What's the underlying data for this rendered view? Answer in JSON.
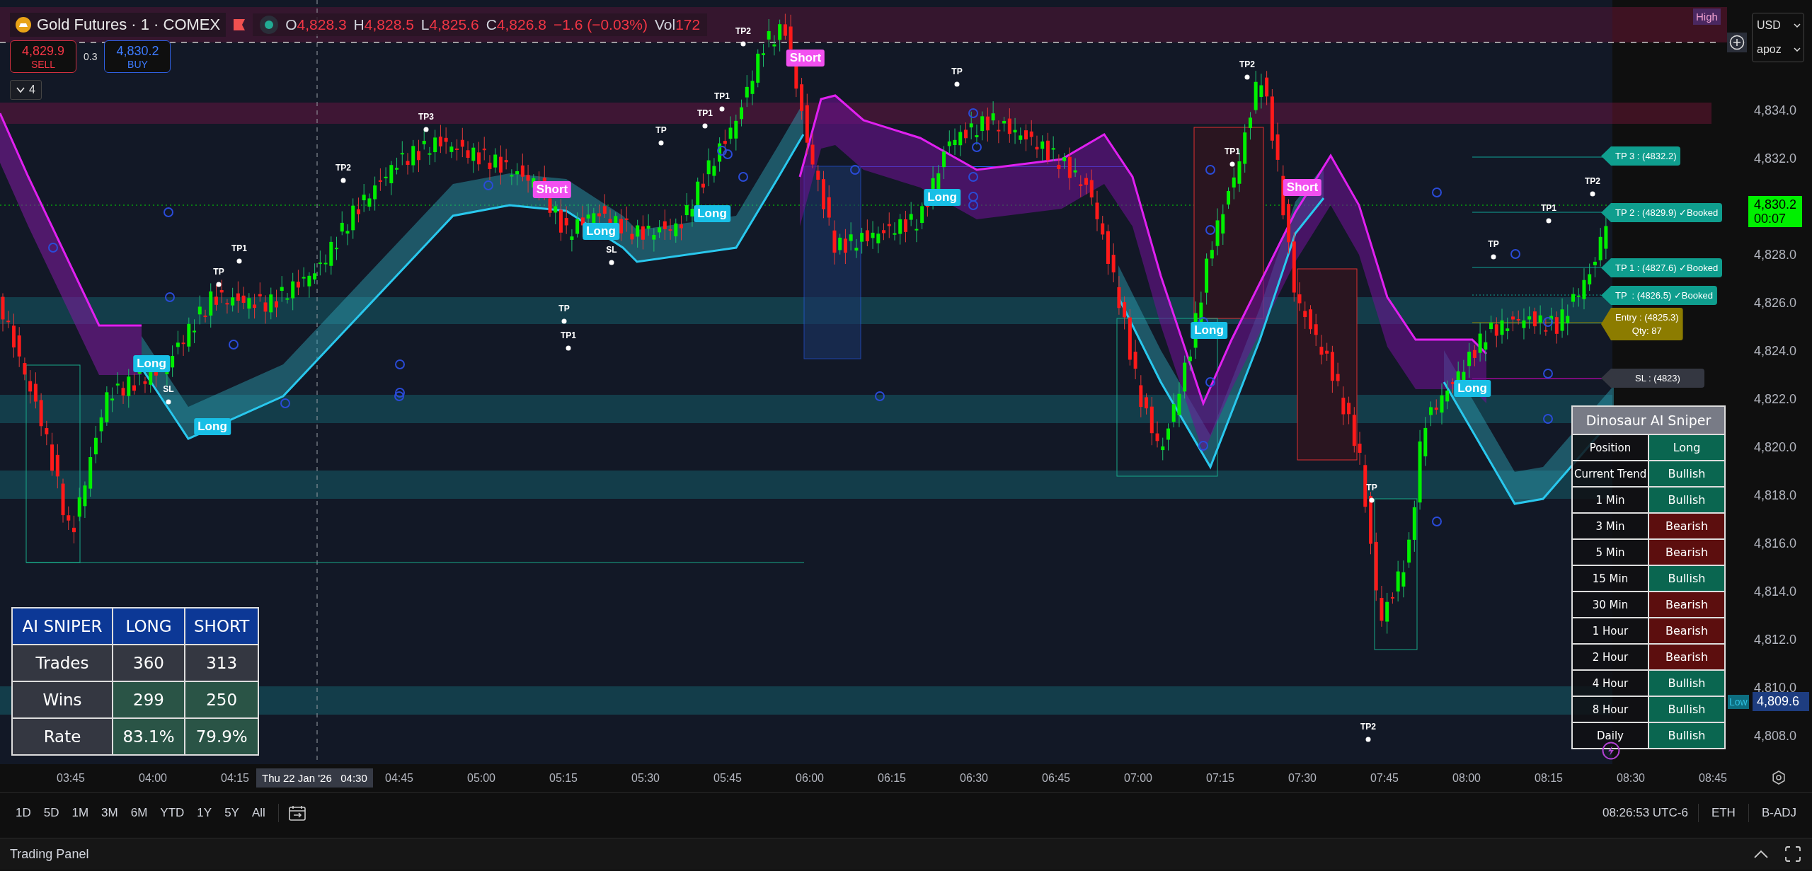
{
  "header": {
    "symbol": "Gold Futures · 1 · COMEX",
    "ohlc": [
      {
        "label": "O",
        "value": "4,828.3"
      },
      {
        "label": "H",
        "value": "4,828.5"
      },
      {
        "label": "L",
        "value": "4,825.6"
      },
      {
        "label": "C",
        "value": "4,826.8"
      }
    ],
    "change": "−1.6 (−0.03%)",
    "volume": {
      "label": "Vol",
      "value": "172"
    }
  },
  "trade_buttons": {
    "sell": {
      "price": "4,829.9",
      "label": "SELL"
    },
    "spread": "0.3",
    "buy": {
      "price": "4,830.2",
      "label": "BUY"
    }
  },
  "indicator_toggle": {
    "count": "4",
    "expanded": false
  },
  "signals": [
    {
      "kind": "long",
      "label": "Long"
    },
    {
      "kind": "long",
      "label": "Long"
    },
    {
      "kind": "short",
      "label": "Short"
    },
    {
      "kind": "long",
      "label": "Long"
    },
    {
      "kind": "long",
      "label": "Long"
    },
    {
      "kind": "short",
      "label": "Short"
    },
    {
      "kind": "long",
      "label": "Long"
    },
    {
      "kind": "long",
      "label": "Long"
    },
    {
      "kind": "short",
      "label": "Short"
    },
    {
      "kind": "long",
      "label": "Long"
    }
  ],
  "targets": [
    "TP3",
    "TP2",
    "TP1",
    "TP",
    "SL",
    "TP",
    "TP1",
    "SL",
    "TP",
    "TP1",
    "TP1",
    "TP2",
    "TP",
    "TP2",
    "TP1",
    "TP",
    "TP2",
    "TP",
    "TP1",
    "TP2"
  ],
  "price_tags": [
    {
      "kind": "tp",
      "text": "TP 3 : (4832.2)"
    },
    {
      "kind": "tp",
      "text": "TP 2 : (4829.9) ✓Booked"
    },
    {
      "kind": "tp",
      "text": "TP 1 : (4827.6) ✓Booked"
    },
    {
      "kind": "tp",
      "text": "TP  : (4826.5) ✓Booked"
    },
    {
      "kind": "entry",
      "text": "Entry : (4825.3)",
      "qty": "Qty: 87"
    },
    {
      "kind": "sl",
      "text": "SL : (4823)"
    }
  ],
  "stats_table": {
    "columns": [
      "AI SNIPER",
      "LONG",
      "SHORT"
    ],
    "rows": [
      {
        "label": "Trades",
        "values": [
          "360",
          "313"
        ],
        "highlight": false
      },
      {
        "label": "Wins",
        "values": [
          "299",
          "250"
        ],
        "highlight": true
      },
      {
        "label": "Rate",
        "values": [
          "83.1%",
          "79.9%"
        ],
        "highlight": true
      }
    ]
  },
  "trend_table": {
    "title": "Dinosaur AI Sniper",
    "rows": [
      {
        "label": "Position",
        "value": "Long",
        "kind": "bullish"
      },
      {
        "label": "Current Trend",
        "value": "Bullish",
        "kind": "bullish"
      },
      {
        "label": "1 Min",
        "value": "Bullish",
        "kind": "bullish"
      },
      {
        "label": "3 Min",
        "value": "Bearish",
        "kind": "bearish"
      },
      {
        "label": "5 Min",
        "value": "Bearish",
        "kind": "bearish"
      },
      {
        "label": "15 Min",
        "value": "Bullish",
        "kind": "bullish"
      },
      {
        "label": "30 Min",
        "value": "Bearish",
        "kind": "bearish"
      },
      {
        "label": "1 Hour",
        "value": "Bearish",
        "kind": "bearish"
      },
      {
        "label": "2 Hour",
        "value": "Bearish",
        "kind": "bearish"
      },
      {
        "label": "4 Hour",
        "value": "Bullish",
        "kind": "bullish"
      },
      {
        "label": "8 Hour",
        "value": "Bullish",
        "kind": "bullish"
      },
      {
        "label": "Daily",
        "value": "Bullish",
        "kind": "bullish"
      }
    ]
  },
  "price_axis": {
    "labels": [
      "4,834.0",
      "4,832.0",
      "4,828.0",
      "4,826.0",
      "4,824.0",
      "4,822.0",
      "4,820.0",
      "4,818.0",
      "4,816.0",
      "4,814.0",
      "4,812.0",
      "4,810.0",
      "4,808.0"
    ],
    "current": {
      "price": "4,830.2",
      "countdown": "00:07"
    },
    "high": "High",
    "low": {
      "label": "Low",
      "price": "4,809.6"
    },
    "currency": "USD",
    "unit": "apoz"
  },
  "time_axis": {
    "labels": [
      "03:45",
      "04:00",
      "04:15",
      "04:45",
      "05:00",
      "05:15",
      "05:30",
      "05:45",
      "06:00",
      "06:15",
      "06:30",
      "06:45",
      "07:00",
      "07:15",
      "07:30",
      "07:45",
      "08:00",
      "08:15",
      "08:30",
      "08:45"
    ],
    "crosshair": "Thu 22 Jan '26   04:30"
  },
  "toolbar": {
    "ranges": [
      "1D",
      "5D",
      "1M",
      "3M",
      "6M",
      "YTD",
      "1Y",
      "5Y",
      "All"
    ],
    "clock": "08:26:53 UTC-6",
    "session": "ETH",
    "adjustment": "B-ADJ"
  },
  "panel": {
    "title": "Trading Panel"
  }
}
